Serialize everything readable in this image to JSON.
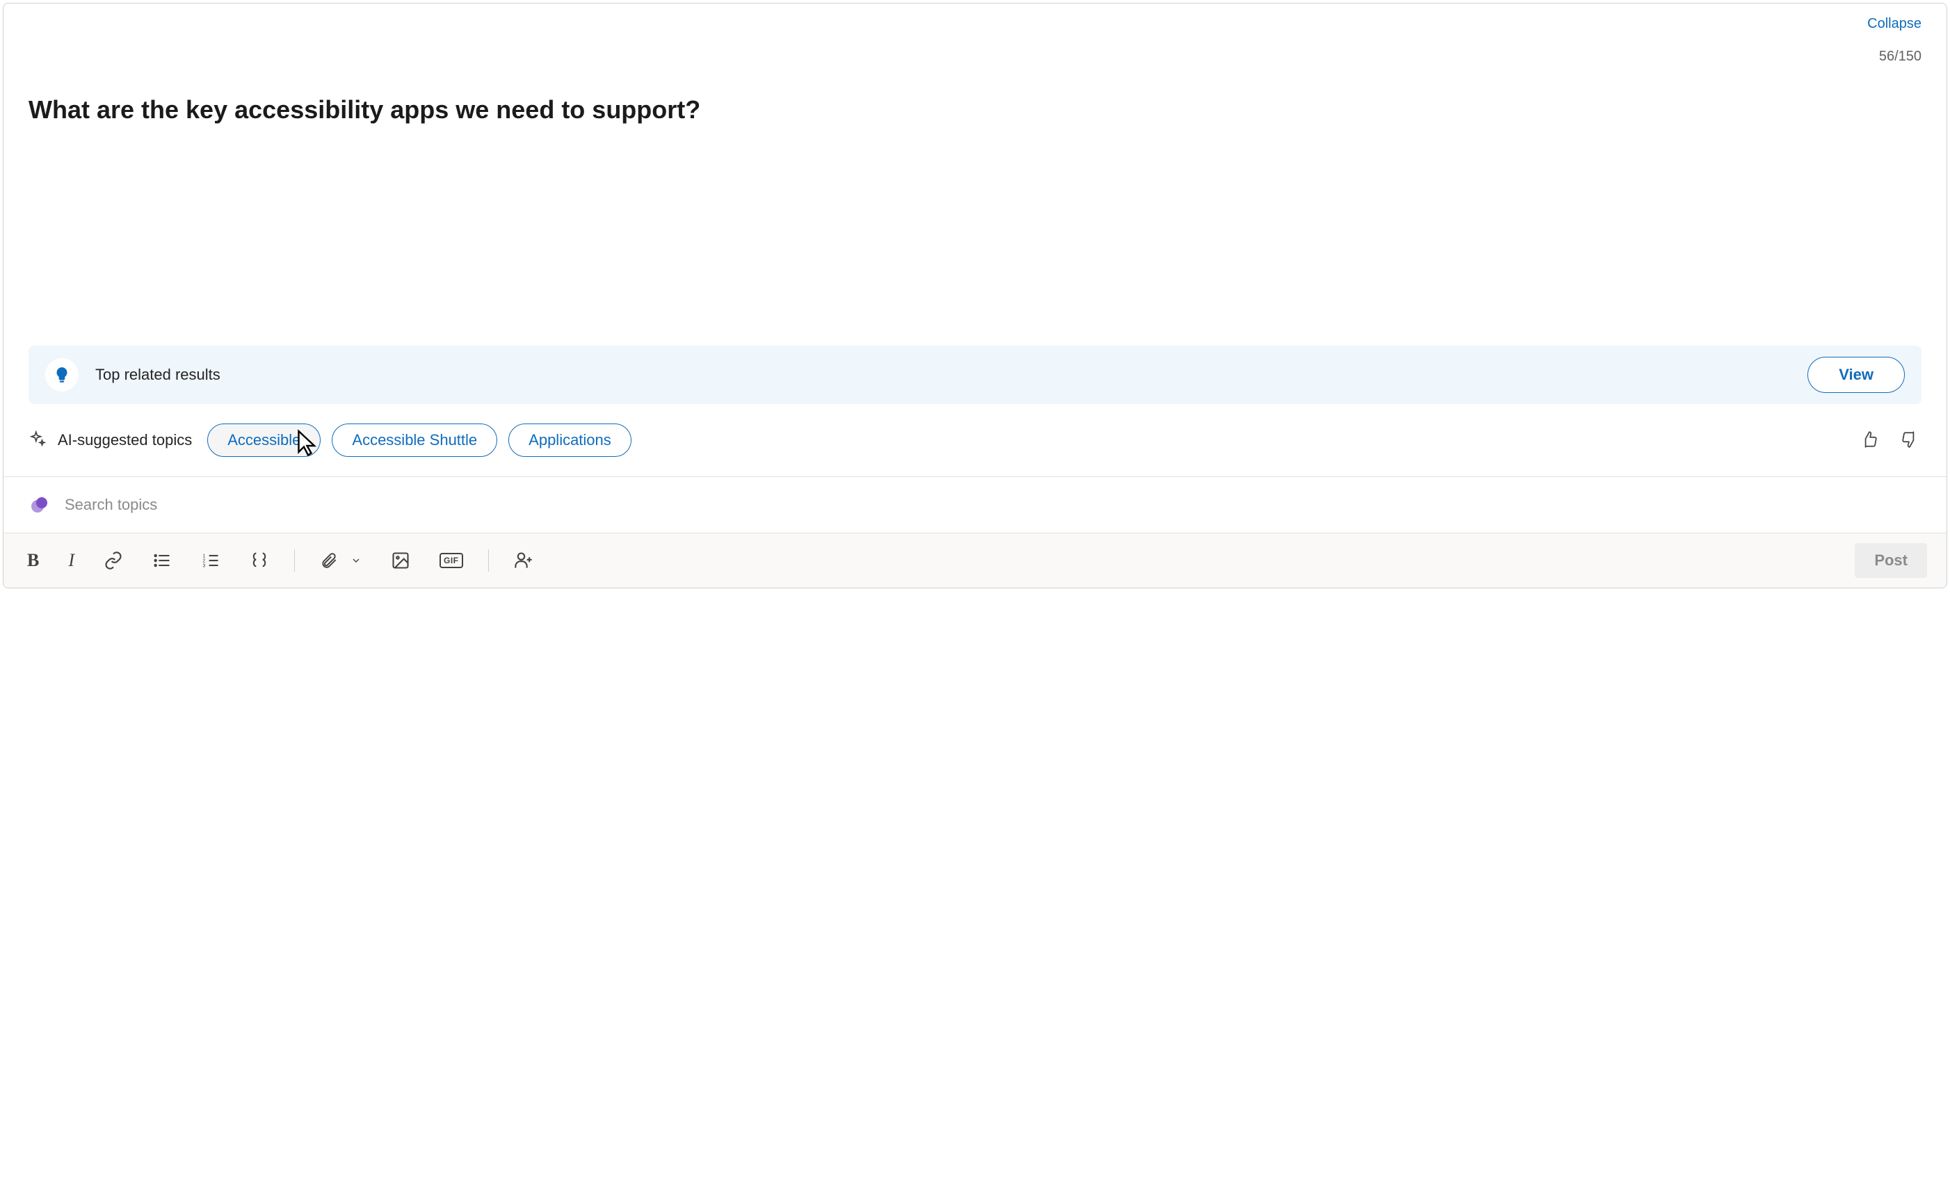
{
  "header": {
    "collapse_label": "Collapse",
    "char_count": "56/150",
    "title": "What are the key accessibility apps we need to support?"
  },
  "related": {
    "label": "Top related results",
    "view_label": "View"
  },
  "ai_suggest": {
    "label": "AI-suggested topics",
    "pills": [
      "Accessible",
      "Accessible Shuttle",
      "Applications"
    ]
  },
  "search": {
    "placeholder": "Search topics"
  },
  "toolbar": {
    "gif_label": "GIF",
    "post_label": "Post"
  }
}
